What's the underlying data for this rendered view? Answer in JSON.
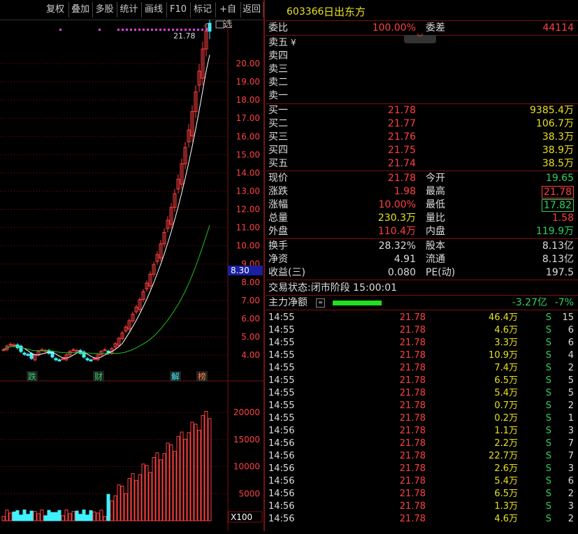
{
  "toolbar": [
    "复权",
    "叠加",
    "多股",
    "统计",
    "画线",
    "F10",
    "标记",
    "+自选",
    "返回"
  ],
  "stock": {
    "code": "603366",
    "name": "日出东方"
  },
  "weibi": {
    "label": "委比",
    "value": "100.00%",
    "wc_label": "委差",
    "wc_value": "44114"
  },
  "sell_orders": [
    {
      "label": "卖五",
      "marker": "¥"
    },
    {
      "label": "卖四",
      "marker": ""
    },
    {
      "label": "卖三",
      "marker": ""
    },
    {
      "label": "卖二",
      "marker": ""
    },
    {
      "label": "卖一",
      "marker": ""
    }
  ],
  "buy_orders": [
    {
      "label": "买一",
      "price": "21.78",
      "volume": "9385.4万"
    },
    {
      "label": "买二",
      "price": "21.77",
      "volume": "106.7万"
    },
    {
      "label": "买三",
      "price": "21.76",
      "volume": "38.3万"
    },
    {
      "label": "买四",
      "price": "21.75",
      "volume": "38.9万"
    },
    {
      "label": "买五",
      "price": "21.74",
      "volume": "38.5万"
    }
  ],
  "quote": [
    {
      "l1": "现价",
      "v1": "21.78",
      "c1": "red",
      "l2": "今开",
      "v2": "19.65",
      "c2": "green"
    },
    {
      "l1": "涨跌",
      "v1": "1.98",
      "c1": "red",
      "l2": "最高",
      "v2": "21.78",
      "c2": "red",
      "box2": "red"
    },
    {
      "l1": "涨幅",
      "v1": "10.00%",
      "c1": "red",
      "l2": "最低",
      "v2": "17.82",
      "c2": "green",
      "box2": "green"
    },
    {
      "l1": "总量",
      "v1": "230.3万",
      "c1": "yellow",
      "l2": "量比",
      "v2": "1.58",
      "c2": "red"
    },
    {
      "l1": "外盘",
      "v1": "110.4万",
      "c1": "red",
      "l2": "内盘",
      "v2": "119.9万",
      "c2": "green"
    }
  ],
  "fundamentals": [
    {
      "l1": "换手",
      "v1": "28.32%",
      "l2": "股本",
      "v2": "8.13亿"
    },
    {
      "l1": "净资",
      "v1": "4.91",
      "l2": "流通",
      "v2": "8.13亿"
    },
    {
      "l1": "收益(三)",
      "v1": "0.080",
      "l2": "PE(动)",
      "v2": "197.5"
    }
  ],
  "trade_status": "交易状态:闭市阶段 15:00:01",
  "main_flow": {
    "label": "主力净额",
    "value": "-3.27亿",
    "pct": "-7%",
    "bar_fraction": 0.7
  },
  "ticks": [
    {
      "t": "14:55",
      "p": "21.78",
      "v": "46.4万",
      "d": "S",
      "n": "15"
    },
    {
      "t": "14:55",
      "p": "21.78",
      "v": "4.6万",
      "d": "S",
      "n": "6"
    },
    {
      "t": "14:55",
      "p": "21.78",
      "v": "3.3万",
      "d": "S",
      "n": "6"
    },
    {
      "t": "14:55",
      "p": "21.78",
      "v": "10.9万",
      "d": "S",
      "n": "4"
    },
    {
      "t": "14:55",
      "p": "21.78",
      "v": "7.4万",
      "d": "S",
      "n": "2"
    },
    {
      "t": "14:55",
      "p": "21.78",
      "v": "6.5万",
      "d": "S",
      "n": "5"
    },
    {
      "t": "14:55",
      "p": "21.78",
      "v": "5.4万",
      "d": "S",
      "n": "5"
    },
    {
      "t": "14:55",
      "p": "21.78",
      "v": "0.7万",
      "d": "S",
      "n": "2"
    },
    {
      "t": "14:55",
      "p": "21.78",
      "v": "0.2万",
      "d": "S",
      "n": "1"
    },
    {
      "t": "14:56",
      "p": "21.78",
      "v": "1.1万",
      "d": "S",
      "n": "3"
    },
    {
      "t": "14:56",
      "p": "21.78",
      "v": "2.2万",
      "d": "S",
      "n": "7"
    },
    {
      "t": "14:56",
      "p": "21.78",
      "v": "22.7万",
      "d": "S",
      "n": "7"
    },
    {
      "t": "14:56",
      "p": "21.78",
      "v": "2.6万",
      "d": "S",
      "n": "3"
    },
    {
      "t": "14:56",
      "p": "21.78",
      "v": "5.4万",
      "d": "S",
      "n": "6"
    },
    {
      "t": "14:56",
      "p": "21.78",
      "v": "6.5万",
      "d": "S",
      "n": "2"
    },
    {
      "t": "14:56",
      "p": "21.78",
      "v": "1.3万",
      "d": "S",
      "n": "3"
    },
    {
      "t": "14:56",
      "p": "21.78",
      "v": "4.6万",
      "d": "S",
      "n": "2"
    }
  ],
  "chart_data": {
    "type": "candlestick",
    "price_axis": [
      "20.00",
      "19.00",
      "18.00",
      "17.00",
      "16.00",
      "15.00",
      "14.00",
      "13.00",
      "12.00",
      "11.00",
      "10.00",
      "9.00",
      "8.00",
      "7.00",
      "6.00",
      "5.00",
      "4.00"
    ],
    "current_marker": "8.30",
    "high_label": "21.78",
    "event_labels": [
      "跌",
      "财",
      "解",
      "榜"
    ],
    "volume_axis": [
      "20000",
      "15000",
      "10000",
      "5000"
    ],
    "volume_unit": "X100",
    "colors": {
      "up": "#ff4040",
      "down": "#40f0ff",
      "ma_white": "#ffffff",
      "ma_green": "#20c020",
      "ma_yellow": "#e8e020"
    }
  }
}
